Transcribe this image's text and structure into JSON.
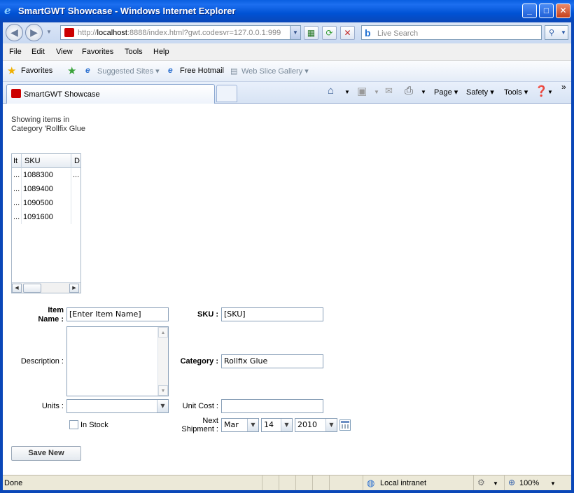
{
  "window": {
    "title": "SmartGWT Showcase - Windows Internet Explorer",
    "controls": {
      "minimize": "_",
      "maximize": "□",
      "close": "✕"
    }
  },
  "address_bar": {
    "url_prefix": "http://",
    "url_host": "localhost",
    "url_rest": ":8888/index.html?gwt.codesvr=127.0.0.1:999",
    "search_placeholder": "Live Search"
  },
  "menu": [
    "File",
    "Edit",
    "View",
    "Favorites",
    "Tools",
    "Help"
  ],
  "favorites_bar": {
    "favorites_label": "Favorites",
    "suggested_sites": "Suggested Sites",
    "free_hotmail": "Free Hotmail",
    "web_slice_gallery": "Web Slice Gallery"
  },
  "tabs": [
    {
      "label": "SmartGWT Showcase"
    }
  ],
  "command_bar": {
    "page": "Page",
    "safety": "Safety",
    "tools": "Tools"
  },
  "content": {
    "showing_text": "Showing items in Category 'Rollfix Glue",
    "grid": {
      "headers": [
        "It",
        "SKU",
        "D"
      ],
      "rows": [
        {
          "item": "...",
          "sku": "1088300",
          "desc": "..."
        },
        {
          "item": "...",
          "sku": "1089400",
          "desc": ""
        },
        {
          "item": "...",
          "sku": "1090500",
          "desc": ""
        },
        {
          "item": "...",
          "sku": "1091600",
          "desc": ""
        }
      ]
    },
    "form": {
      "item_name_label": "Item Name :",
      "item_name_value": "[Enter Item Name]",
      "sku_label": "SKU :",
      "sku_value": "[SKU]",
      "description_label": "Description :",
      "category_label": "Category :",
      "category_value": "Rollfix Glue",
      "units_label": "Units :",
      "units_value": "",
      "unit_cost_label": "Unit Cost :",
      "unit_cost_value": "",
      "in_stock_label": "In Stock",
      "in_stock_checked": false,
      "next_shipment_label_1": "Next",
      "next_shipment_label_2": "Shipment :",
      "ship_month": "Mar",
      "ship_day": "14",
      "ship_year": "2010"
    },
    "save_button": "Save New"
  },
  "status_bar": {
    "status": "Done",
    "zone": "Local intranet",
    "zoom": "100%"
  }
}
